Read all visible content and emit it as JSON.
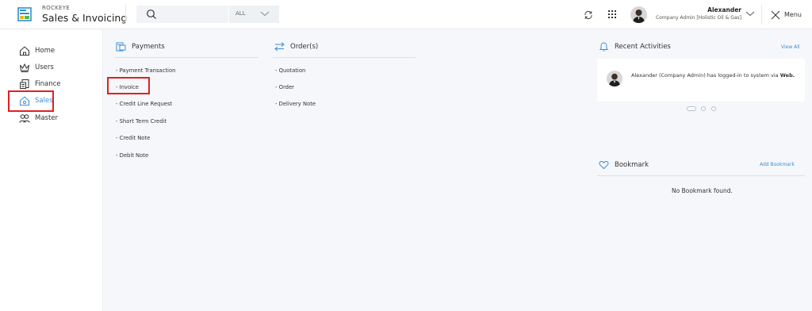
{
  "header": {
    "brand_sub": "ROCKEYE",
    "brand_title": "Sales & Invoicing",
    "search_scope": "ALL",
    "user_name": "Alexander",
    "user_role": "Company Admin [Holistic Oil & Gas]",
    "menu_label": "Menu"
  },
  "sidebar": {
    "items": [
      {
        "label": "Home",
        "icon": "home-icon"
      },
      {
        "label": "Users",
        "icon": "crown-icon"
      },
      {
        "label": "Finance",
        "icon": "finance-icon"
      },
      {
        "label": "Sales",
        "icon": "sales-icon"
      },
      {
        "label": "Master",
        "icon": "users-icon"
      }
    ],
    "active": "Sales"
  },
  "payments": {
    "heading": "Payments",
    "links": [
      "- Payment Transaction",
      "- Invoice",
      "- Credit Line Request",
      "- Short Term Credit",
      "- Credit Note",
      "- Debit Note"
    ]
  },
  "orders": {
    "heading": "Order(s)",
    "links": [
      "- Quotation",
      "- Order",
      "- Delivery Note"
    ]
  },
  "recent": {
    "heading": "Recent Activities",
    "view_all": "View All",
    "activity_user": "Alexander (Company Admin)",
    "activity_mid": " has logged-in to system via ",
    "activity_channel": "Web."
  },
  "bookmark": {
    "heading": "Bookmark",
    "add": "Add Bookmark",
    "empty": "No Bookmark found."
  },
  "colors": {
    "accent": "#3a8fd6",
    "highlight": "#e02020"
  }
}
